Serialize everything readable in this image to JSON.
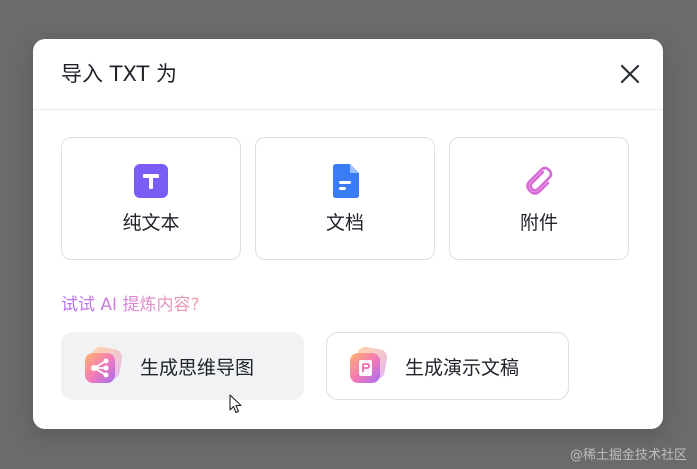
{
  "dialog": {
    "title": "导入 TXT 为",
    "close_icon": "close-icon"
  },
  "options": [
    {
      "label": "纯文本",
      "icon": "text-t-icon",
      "color": "#7b5cf5"
    },
    {
      "label": "文档",
      "icon": "document-icon",
      "color": "#3a7cf5"
    },
    {
      "label": "附件",
      "icon": "paperclip-icon",
      "color": "#d86ad8"
    }
  ],
  "ai": {
    "hint": "试试 AI 提炼内容?",
    "actions": [
      {
        "label": "生成思维导图",
        "icon": "mindmap-icon",
        "hovered": true
      },
      {
        "label": "生成演示文稿",
        "icon": "presentation-icon",
        "hovered": false
      }
    ]
  },
  "watermark": "@稀土掘金技术社区"
}
